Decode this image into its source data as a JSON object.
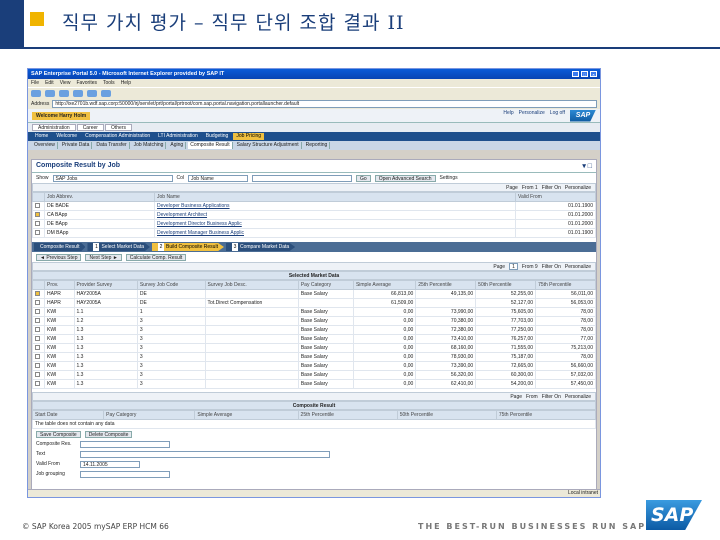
{
  "slide": {
    "title": "직무 가치 평가 – 직무 단위 조합 결과 II",
    "copyright": "SAP Korea 2005  mySAP ERP HCM  66",
    "tagline": "THE BEST-RUN BUSINESSES RUN SAP",
    "logo": "SAP"
  },
  "window": {
    "title": "SAP Enterprise Portal 5.0 - Microsoft Internet Explorer provided by SAP IT",
    "menu": [
      "File",
      "Edit",
      "View",
      "Favorites",
      "Tools",
      "Help"
    ],
    "address_label": "Address",
    "address": "http://ixe2701b.wdf.sap.corp:50000/irj/servlet/prt/portal/prtroot/com.sap.portal.navigation.portallauncher.default",
    "status_left": "",
    "status_right": "Local intranet"
  },
  "portal": {
    "welcome": "Welcome Harry Holm",
    "links": [
      "Help",
      "Personalize",
      "Log off"
    ],
    "tabs_top": [
      "Administration",
      "Career",
      "Others"
    ],
    "tabs_main": [
      "Home",
      "Welcome",
      "Compensation Administration",
      "LTI Administration",
      "Budgeting",
      "Job Pricing"
    ],
    "tabs_sub": [
      "Overview",
      "Private Data",
      "Data Transfer",
      "Job Matching",
      "Aging",
      "Composite Result",
      "Salary Structure Adjustment",
      "Reporting"
    ],
    "active_main": "Job Pricing",
    "active_sub": "Composite Result"
  },
  "search": {
    "section_title": "Composite Result by Job",
    "show_label": "Show",
    "show_value": "SAP Jobs",
    "col_label": "Col",
    "col_value": "Job Name",
    "go_label": "Go",
    "advanced_label": "Open Advanced Search",
    "settings_label": "Settings"
  },
  "jobs": {
    "pager": [
      "Page",
      "From 1",
      "Filter On",
      "Personalize"
    ],
    "columns": [
      "Job Abbrev.",
      "Job Name",
      "Valid From"
    ],
    "rows": [
      {
        "abbrev": "DE BADE",
        "name": "Developer Business Applications",
        "valid": "01.01.1900",
        "selected": false
      },
      {
        "abbrev": "CA BApp",
        "name": "Development Architect",
        "valid": "01.01.2000",
        "selected": true
      },
      {
        "abbrev": "DE BApp",
        "name": "Development Director Business Applic",
        "valid": "01.01.2000",
        "selected": false
      },
      {
        "abbrev": "DM BApp",
        "name": "Development Manager Business Applic",
        "valid": "01.01.1900",
        "selected": false
      }
    ]
  },
  "steps": [
    {
      "num": "",
      "label": "Composite Result"
    },
    {
      "num": "1",
      "label": "Select Market Data"
    },
    {
      "num": "2",
      "label": "Build Composite Result"
    },
    {
      "num": "3",
      "label": "Compare Market Data"
    }
  ],
  "actions": [
    "Previous Step",
    "Next Step",
    "Calculate Comp. Result"
  ],
  "market": {
    "pager": [
      "Page",
      "1",
      "From 9",
      "Filter On",
      "Personalize"
    ],
    "band": "Selected Market Data",
    "columns": [
      "Prov.",
      "Provider Survey",
      "Survey Job Code",
      "Survey Job Desc.",
      "Pay Category",
      "Simple Average",
      "25th Percentile",
      "50th Percentile",
      "75th Percentile"
    ],
    "rows": [
      {
        "prov": "HAPR",
        "survey": "HAY2005A",
        "code": "DE",
        "desc": "",
        "cat": "Base Salary",
        "avg": "66,813,00",
        "p25": "49,135,00",
        "p50": "52,255,00",
        "p75": "56,011,00"
      },
      {
        "prov": "HAPR",
        "survey": "HAY2005A",
        "code": "DE",
        "desc": "Tot.Direct Compensation",
        "cat": "",
        "avg": "61,509,00",
        "p25": "",
        "p50": "52,127,00",
        "p75": "56,053,00"
      },
      {
        "prov": "KWI",
        "survey": "1.1",
        "code": "1",
        "desc": "",
        "cat": "Base Salary",
        "avg": "0,00",
        "p25": "73,990,00",
        "p50": "75,605,00",
        "p75": "78,00"
      },
      {
        "prov": "KWI",
        "survey": "1.2",
        "code": "3",
        "desc": "",
        "cat": "Base Salary",
        "avg": "0,00",
        "p25": "70,380,00",
        "p50": "77,703,00",
        "p75": "78,00"
      },
      {
        "prov": "KWI",
        "survey": "1.3",
        "code": "3",
        "desc": "",
        "cat": "Base Salary",
        "avg": "0,00",
        "p25": "72,380,00",
        "p50": "77,250,00",
        "p75": "78,00"
      },
      {
        "prov": "KWI",
        "survey": "1.3",
        "code": "3",
        "desc": "",
        "cat": "Base Salary",
        "avg": "0,00",
        "p25": "73,410,00",
        "p50": "76,257,00",
        "p75": "77,00"
      },
      {
        "prov": "KWI",
        "survey": "1.3",
        "code": "3",
        "desc": "",
        "cat": "Base Salary",
        "avg": "0,00",
        "p25": "68,160,00",
        "p50": "71,555,00",
        "p75": "75,213,00"
      },
      {
        "prov": "KWI",
        "survey": "1.3",
        "code": "3",
        "desc": "",
        "cat": "Base Salary",
        "avg": "0,00",
        "p25": "78,930,00",
        "p50": "75,187,00",
        "p75": "78,00"
      },
      {
        "prov": "KWI",
        "survey": "1.3",
        "code": "3",
        "desc": "",
        "cat": "Base Salary",
        "avg": "0,00",
        "p25": "73,390,00",
        "p50": "72,665,00",
        "p75": "56,660,00"
      },
      {
        "prov": "KWI",
        "survey": "1.3",
        "code": "3",
        "desc": "",
        "cat": "Base Salary",
        "avg": "0,00",
        "p25": "56,320,00",
        "p50": "60,300,00",
        "p75": "57,032,00"
      },
      {
        "prov": "KWI",
        "survey": "1.3",
        "code": "3",
        "desc": "",
        "cat": "Base Salary",
        "avg": "0,00",
        "p25": "62,410,00",
        "p50": "54,200,00",
        "p75": "57,450,00"
      }
    ]
  },
  "composite": {
    "pager": [
      "Page",
      "From",
      "Filter On",
      "Personalize"
    ],
    "band": "Composite Result",
    "columns": [
      "Start Date",
      "Pay Category",
      "Simple Average",
      "25th Percentile",
      "50th Percentile",
      "75th Percentile"
    ],
    "empty_text": "The table does not contain any data",
    "save_label": "Save Composite",
    "delete_label": "Delete Composite"
  },
  "form": {
    "fields": [
      {
        "label": "Composite Res.",
        "value": ""
      },
      {
        "label": "Text",
        "value": ""
      },
      {
        "label": "Valid From",
        "value": "14.11.2005"
      },
      {
        "label": "Job grouping",
        "value": ""
      }
    ]
  }
}
